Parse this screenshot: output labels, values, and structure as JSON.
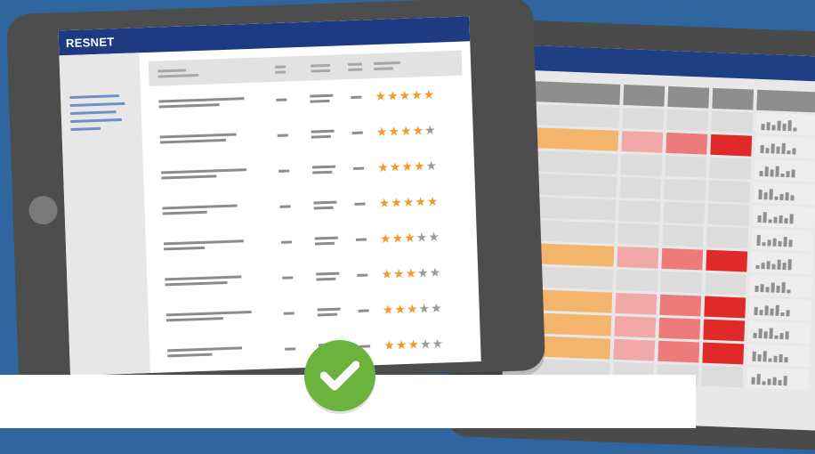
{
  "brand": {
    "name": "RESNET"
  },
  "colors": {
    "background": "#2f66a0",
    "header_bar": "#1c3b82",
    "star_on": "#f29a2e",
    "star_off": "#9a9a9a",
    "check_badge": "#6cb33e",
    "heat_orange": "#f3b46b",
    "heat_light_red": "#f3a8a8",
    "heat_mid_red": "#ee7b7b",
    "heat_red": "#e02a2a"
  },
  "listing": {
    "rows": [
      {
        "rating": 5
      },
      {
        "rating": 4
      },
      {
        "rating": 4
      },
      {
        "rating": 5
      },
      {
        "rating": 3
      },
      {
        "rating": 3
      },
      {
        "rating": 3
      },
      {
        "rating": 3
      }
    ],
    "max_rating": 5
  },
  "spreadsheet": {
    "rows": [
      {
        "heat": [
          "header",
          "header",
          "header",
          "header"
        ]
      },
      {
        "heat": [
          "none",
          "none",
          "none",
          "none"
        ]
      },
      {
        "heat": [
          "orange",
          "light_red",
          "mid_red",
          "red"
        ]
      },
      {
        "heat": [
          "none",
          "none",
          "none",
          "none"
        ]
      },
      {
        "heat": [
          "none",
          "none",
          "none",
          "none"
        ]
      },
      {
        "heat": [
          "none",
          "none",
          "none",
          "none"
        ]
      },
      {
        "heat": [
          "none",
          "none",
          "none",
          "none"
        ]
      },
      {
        "heat": [
          "orange",
          "light_red",
          "mid_red",
          "red"
        ]
      },
      {
        "heat": [
          "none",
          "none",
          "none",
          "none"
        ]
      },
      {
        "heat": [
          "orange",
          "light_red",
          "mid_red",
          "red"
        ]
      },
      {
        "heat": [
          "orange",
          "light_red",
          "mid_red",
          "red"
        ]
      },
      {
        "heat": [
          "orange",
          "light_red",
          "mid_red",
          "red"
        ]
      },
      {
        "heat": [
          "none",
          "none",
          "none",
          "none"
        ]
      }
    ]
  },
  "icons": {
    "check": "check-icon",
    "star": "star-icon",
    "home_button": "home-button-icon"
  }
}
